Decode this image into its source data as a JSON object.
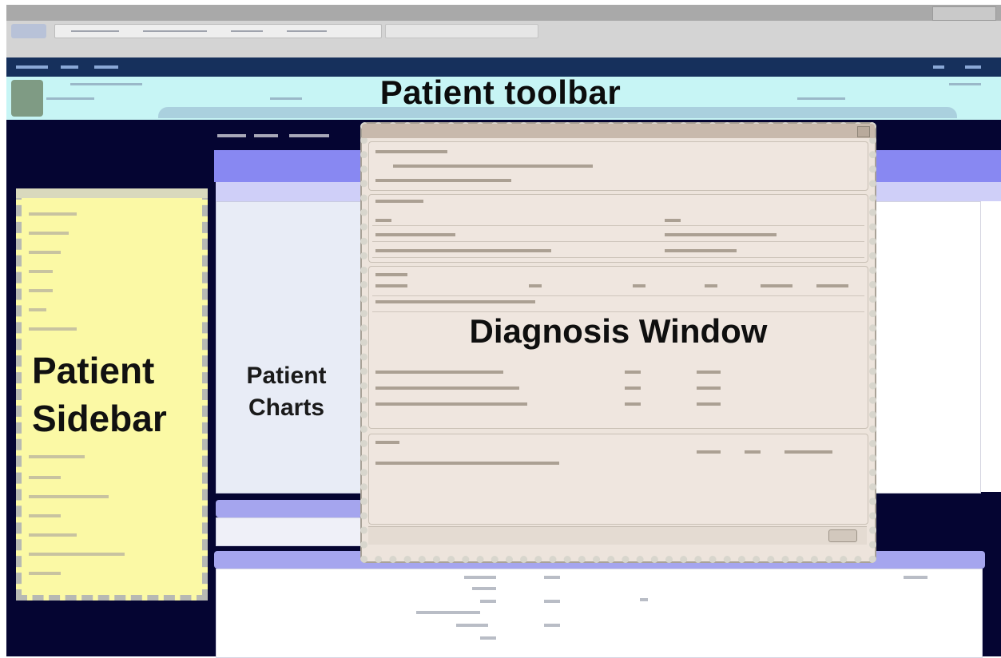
{
  "labels": {
    "patient_toolbar": "Patient toolbar",
    "patient_sidebar": "Patient Sidebar",
    "patient_charts": "Patient Charts",
    "diagnosis_window": "Diagnosis Window"
  },
  "icons": {
    "back": "back-arrow-icon",
    "avatar": "patient-photo-icon",
    "close": "close-icon"
  },
  "colors": {
    "patient_toolbar_bg": "#c7f5f5",
    "patient_sidebar_bg": "#fbf9a5",
    "workspace_bg": "#050532",
    "charts_band": "#8888f2",
    "diagnosis_bg": "#ede4dc"
  }
}
